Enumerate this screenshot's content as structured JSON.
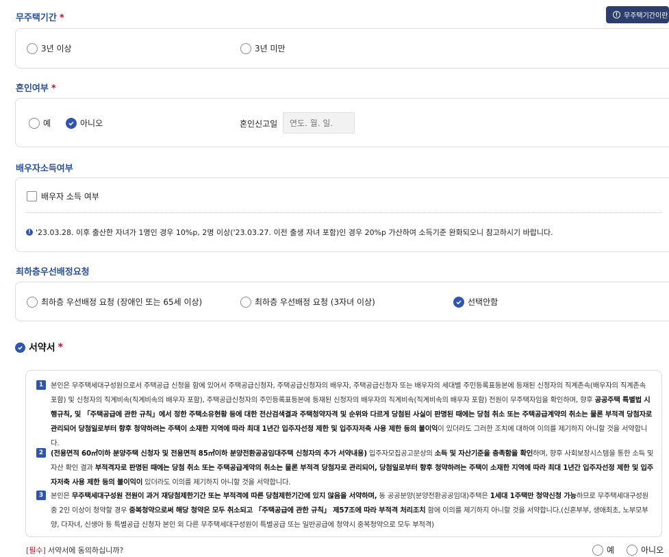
{
  "section1": {
    "title": "무주택기간",
    "required_mark": "*",
    "info_button": "무주택기간이란",
    "info_icon": "info-icon",
    "options": [
      "3년 이상",
      "3년 미만"
    ],
    "selected": null
  },
  "section2": {
    "title": "혼인여부",
    "required_mark": "*",
    "options": [
      "예",
      "아니오"
    ],
    "selected": "아니오",
    "date_label": "혼인신고일",
    "date_placeholder": "연도. 월. 일."
  },
  "section3": {
    "title": "배우자소득여부",
    "checkbox_label": "배우자 소득 여부",
    "checked": false,
    "info_text": "'23.03.28. 이후 출산한 자녀가 1명인 경우 10%p, 2명 이상('23.03.27. 이전 출생 자녀 포함)인 경우 20%p 가산하여 소득기준 완화되오니 참고하시기 바랍니다."
  },
  "section4": {
    "title": "최하층우선배정요청",
    "options": [
      "최하층 우선배정 요청 (장애인 또는 65세 이상)",
      "최하층 우선배정 요청 (3자녀 이상)",
      "선택안함"
    ],
    "selected": "선택안함"
  },
  "pledge": {
    "title": "서약서",
    "required_mark": "*",
    "clauses": [
      {
        "num": "1",
        "parts": [
          {
            "t": "본인은 무주택세대구성원으로서 주택공급 신청을 함에 있어서 주택공급신청자, 주택공급신청자의 배우자, 주택공급신청자 또는 배우자의 세대별 주민등록표등본에 등재된 신청자의 직계존속(배우자의 직계존속 포함) 및 신청자의 직계비속(직계비속의 배우자 포함), 주택공급신청자의 주민등록표등본에 등재된 신청자의 배우자의 직계비속(직계비속의 배우자 포함) 전원이 무주택자임을 확인하며, 향후 ",
            "b": false
          },
          {
            "t": "공공주택 특별법 시행규칙, 및 「주택공급에 관한 규칙」에서 정한 주택소유현황 등에 대한 전산검색결과 주택청약자격 및 순위와 다르게 당첨된 사실이 판명된 때에는 당첨 취소 또는 주택공급계약의 취소는 물론 부적격 당첨자로 관리되어 당첨일로부터 향후 청약하려는 주택이 소재한 지역에 따라 최대 1년간 입주자선정 제한 및 입주자저축 사용 제한 등의 불이익",
            "b": true
          },
          {
            "t": "이 있더라도 그러한 조치에 대하여 이의를 제기하지 아니할 것을 서약합니다.",
            "b": false
          }
        ]
      },
      {
        "num": "2",
        "parts": [
          {
            "t": "(전용면적 60㎡이하 분양주택 신청자 및 전용면적 85㎡이하 분양전환공공임대주택 신청자의 추가 서약내용)",
            "b": true
          },
          {
            "t": " 입주자모집공고문상의 ",
            "b": false
          },
          {
            "t": "소득 및 자산기준을 충족함을 확인",
            "b": true
          },
          {
            "t": "하며, 향후 사회보장시스템을 통한 소득 및 자산 확인 결과 ",
            "b": false
          },
          {
            "t": "부적격자로 판명된 때에는 당첨 취소 또는 주택공급계약의 취소는 물론 부적격 당첨자로 관리되어, 당첨일로부터 향후 청약하려는 주택이 소재한 지역에 따라 최대 1년간 입주자선정 제한 및 입주자저축 사용 제한 등의 불이익이",
            "b": true
          },
          {
            "t": " 있더라도 이의를 제기하지 아니할 것을 서약합니다.",
            "b": false
          }
        ]
      },
      {
        "num": "3",
        "parts": [
          {
            "t": "본인은 ",
            "b": false
          },
          {
            "t": "무주택세대구성원 전원이 과거 재당첨제한기간 또는 부적격에 따른 당첨제한기간에 있지 않음을 서약하며,",
            "b": true
          },
          {
            "t": " 동 공공분양(분양전환공공임대)주택은 ",
            "b": false
          },
          {
            "t": "1세대 1주택만 청약신청 가능",
            "b": true
          },
          {
            "t": "하므로 무주택세대구성원 중 2인 이상이 청약할 경우 ",
            "b": false
          },
          {
            "t": "중복청약으로써 해당 청약은 모두 취소되고 「주택공급에 관한 규칙」 제57조에 따라 부적격 처리조치",
            "b": true
          },
          {
            "t": " 함에 이의를 제기하지 아니할 것을 서약합니다.(신혼부부, 생애최초, 노부모부양, 다자녀, 신생아 등 특별공급 신청자 본인 외 다른 무주택세대구성원이 특별공급 또는 일반공급에 청약시 중복청약으로 모두 부적격)",
            "b": false
          }
        ]
      }
    ],
    "question_req": "[필수]",
    "question": "서약서에 동의하십니까?",
    "answers": [
      "예",
      "아니오"
    ]
  }
}
